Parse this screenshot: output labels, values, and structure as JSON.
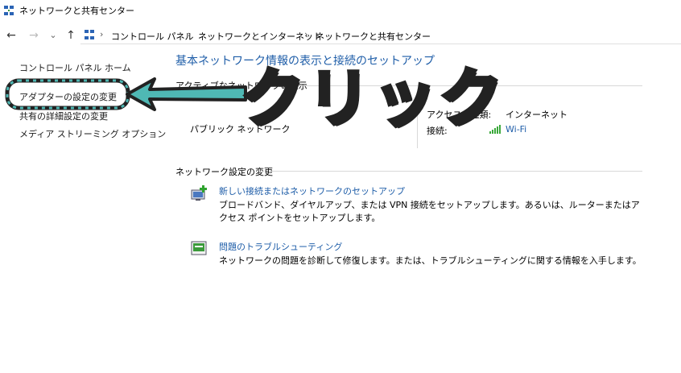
{
  "window": {
    "title": "ネットワークと共有センター"
  },
  "nav": {
    "back_icon": "←",
    "forward_icon": "→",
    "history_icon": "⌄",
    "up_icon": "↑"
  },
  "breadcrumb": [
    "コントロール パネル",
    "ネットワークとインターネット",
    "ネットワークと共有センター"
  ],
  "breadcrumb_sep": "›",
  "sidebar": {
    "home": "コントロール パネル ホーム",
    "items": [
      "アダプターの設定の変更",
      "共有の詳細設定の変更",
      "メディア ストリーミング オプション"
    ]
  },
  "main": {
    "title": "基本ネットワーク情報の表示と接続のセットアップ",
    "active_networks_label": "アクティブなネットワークの表示",
    "network_type": "パブリック ネットワーク",
    "access_type_label": "アクセスの種類:",
    "access_type_value": "インターネット",
    "connection_label": "接続:",
    "connection_value": "Wi-Fi",
    "change_settings_label": "ネットワーク設定の変更",
    "tasks": [
      {
        "title": "新しい接続またはネットワークのセットアップ",
        "desc": "ブロードバンド、ダイヤルアップ、または VPN 接続をセットアップします。あるいは、ルーターまたはアクセス ポイントをセットアップします。"
      },
      {
        "title": "問題のトラブルシューティング",
        "desc": "ネットワークの問題を診断して修復します。または、トラブルシューティングに関する情報を入手します。"
      }
    ]
  },
  "annotation": {
    "text": "クリック",
    "color": "#4fb8b4"
  }
}
